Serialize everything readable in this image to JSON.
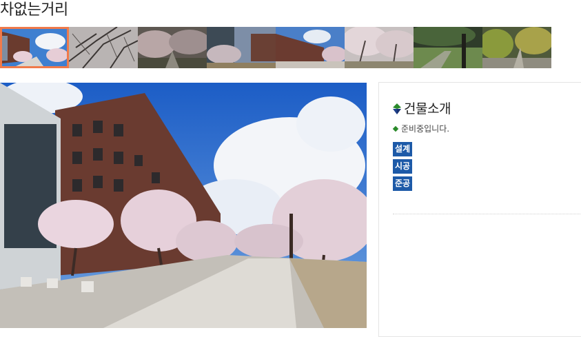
{
  "page": {
    "title": "차없는거리"
  },
  "gallery": {
    "thumbnails": [
      {
        "name": "thumb-1",
        "active": true
      },
      {
        "name": "thumb-2",
        "active": false
      },
      {
        "name": "thumb-3",
        "active": false
      },
      {
        "name": "thumb-4",
        "active": false
      },
      {
        "name": "thumb-5",
        "active": false
      },
      {
        "name": "thumb-6",
        "active": false
      },
      {
        "name": "thumb-7",
        "active": false
      },
      {
        "name": "thumb-8",
        "active": false
      }
    ],
    "accent_color": "#f07a4a"
  },
  "info": {
    "heading": "건물소개",
    "note": "준비중입니다.",
    "tags": [
      "설계",
      "시공",
      "준공"
    ],
    "tag_color": "#1d5aa8"
  }
}
